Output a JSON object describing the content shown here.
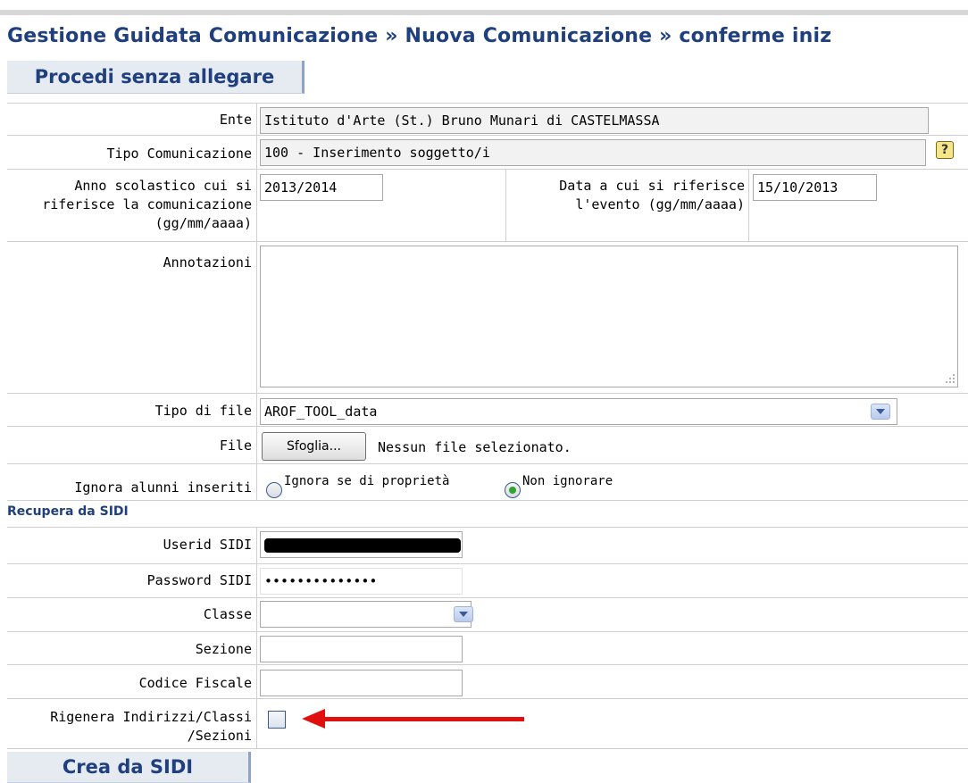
{
  "breadcrumb": "Gestione Guidata Comunicazione » Nuova Comunicazione » conferme iniz",
  "procedi_button": "Procedi senza allegare",
  "form": {
    "ente_label": "Ente",
    "ente_value": "Istituto d'Arte  (St.)  Bruno Munari di CASTELMASSA",
    "tipo_com_label": "Tipo Comunicazione",
    "tipo_com_value": "100 - Inserimento soggetto/i",
    "help_icon": "?",
    "anno_label_1": "Anno scolastico cui si",
    "anno_label_2": "riferisce la comunicazione",
    "anno_label_3": "(gg/mm/aaaa)",
    "anno_value": "2013/2014",
    "data_label_1": "Data a cui si riferisce",
    "data_label_2": "l'evento (gg/mm/aaaa)",
    "data_value": "15/10/2013",
    "annotazioni_label": "Annotazioni",
    "annotazioni_value": "",
    "tipo_file_label": "Tipo di file",
    "tipo_file_value": "AROF_TOOL_data",
    "file_label": "File",
    "browse_button": "Sfoglia...",
    "file_status": "Nessun file selezionato.",
    "ignora_label": "Ignora alunni inseriti",
    "radio_option_1": "Ignora se di proprietà",
    "radio_option_2": "Non ignorare",
    "radio_selected": "Non ignorare"
  },
  "sidi": {
    "section_title": "Recupera da SIDI",
    "userid_label": "Userid SIDI",
    "password_label": "Password SIDI",
    "password_value": "••••••••••••••",
    "classe_label": "Classe",
    "classe_value": "",
    "sezione_label": "Sezione",
    "sezione_value": "",
    "codice_label": "Codice Fiscale",
    "codice_value": "",
    "rigenera_label_1": "Rigenera Indirizzi/Classi",
    "rigenera_label_2": "/Sezioni",
    "rigenera_checked": false,
    "crea_button": "Crea da SIDI"
  },
  "colors": {
    "accent": "#1f3f7e",
    "annotation_arrow": "#e01010"
  }
}
